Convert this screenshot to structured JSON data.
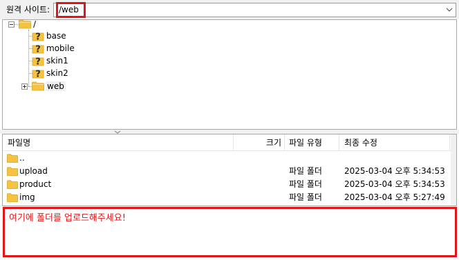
{
  "site_bar": {
    "label": "원격 사이트:",
    "path": "/web"
  },
  "tree": {
    "root": {
      "label": "/"
    },
    "children": [
      {
        "label": "base",
        "icon": "unknown-folder-icon"
      },
      {
        "label": "mobile",
        "icon": "unknown-folder-icon"
      },
      {
        "label": "skin1",
        "icon": "unknown-folder-icon"
      },
      {
        "label": "skin2",
        "icon": "unknown-folder-icon"
      },
      {
        "label": "web",
        "icon": "folder-icon"
      }
    ]
  },
  "file_list": {
    "columns": {
      "name": "파일명",
      "size": "크기",
      "type": "파일 유형",
      "modified": "최종 수정"
    },
    "rows": [
      {
        "name": "..",
        "size": "",
        "type": "",
        "modified": ""
      },
      {
        "name": "upload",
        "size": "",
        "type": "파일 폴더",
        "modified": "2025-03-04 오후 5:34:53"
      },
      {
        "name": "product",
        "size": "",
        "type": "파일 폴더",
        "modified": "2025-03-04 오후 5:34:53"
      },
      {
        "name": "img",
        "size": "",
        "type": "파일 폴더",
        "modified": "2025-03-04 오후 5:27:49"
      }
    ]
  },
  "drop_area": {
    "message": "여기에 폴더를 업로드해주세요!"
  },
  "colors": {
    "highlight": "#e01616",
    "folder": "#f5c242",
    "unknown_mark": "#2b2b2b"
  }
}
